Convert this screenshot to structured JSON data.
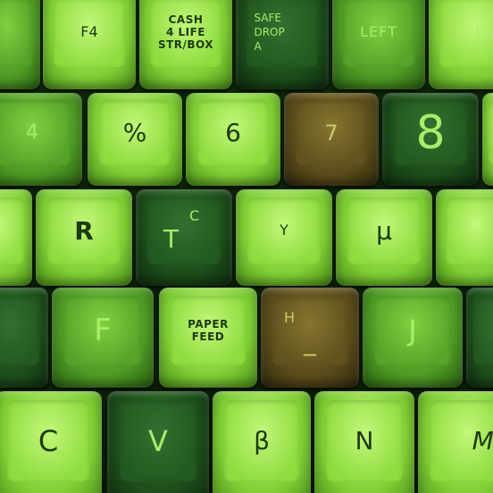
{
  "keys": {
    "f4": "F4",
    "cash_1": "CASH",
    "cash_2": "4 LIFE",
    "cash_3": "STR/BOX",
    "safe_1": "SAFE",
    "safe_2": "DROP",
    "safe_3": "A",
    "left": "LEFT",
    "dia": "DIA",
    "four": "4",
    "percent": "%",
    "six": "6",
    "seven": "7",
    "eight": "8",
    "r": "R",
    "t": "T",
    "t_sub": "C",
    "y": "Y",
    "mu": "μ",
    "f": "F",
    "paper_1": "PAPER",
    "paper_2": "FEED",
    "h": "H",
    "underscore": "_",
    "j": "J",
    "c": "C",
    "v": "V",
    "beta": "β",
    "n": "N",
    "m": "M"
  }
}
